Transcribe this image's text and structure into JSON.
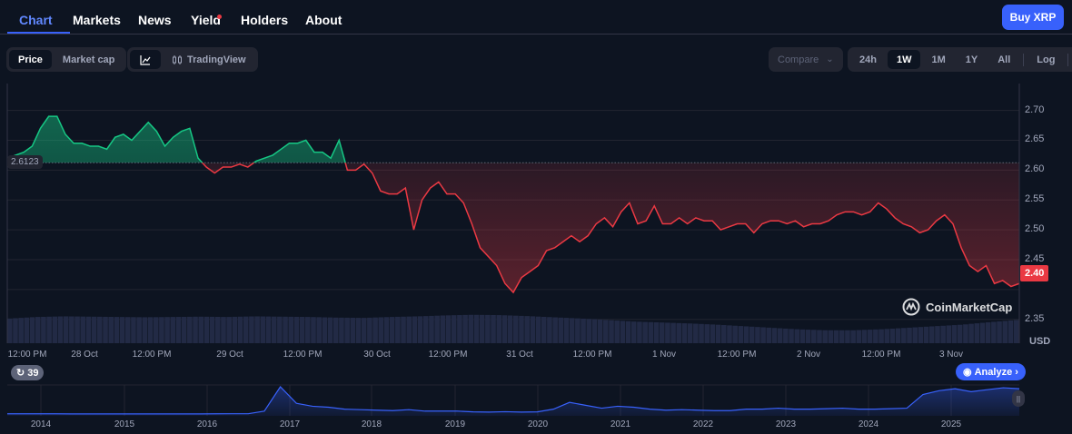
{
  "nav": {
    "tabs": [
      "Chart",
      "Markets",
      "News",
      "Yield",
      "Holders",
      "About"
    ],
    "active": "Chart",
    "buy_label": "Buy XRP"
  },
  "toolbar": {
    "price": "Price",
    "market_cap": "Market cap",
    "tradingview": "TradingView",
    "compare": "Compare",
    "ranges": [
      "24h",
      "1W",
      "1M",
      "1Y",
      "All"
    ],
    "active_range": "1W",
    "log": "Log"
  },
  "chart": {
    "baseline_label": "2.6123",
    "current_label": "2.40",
    "currency": "USD",
    "watermark": "CoinMarketCap",
    "y_ticks": [
      "2.70",
      "2.65",
      "2.60",
      "2.55",
      "2.50",
      "2.45",
      "2.35"
    ],
    "x_ticks": [
      "12:00 PM",
      "28 Oct",
      "12:00 PM",
      "29 Oct",
      "12:00 PM",
      "30 Oct",
      "12:00 PM",
      "31 Oct",
      "12:00 PM",
      "1 Nov",
      "12:00 PM",
      "2 Nov",
      "12:00 PM",
      "3 Nov"
    ],
    "colors": {
      "up": "#16c784",
      "down": "#ea3943",
      "accent": "#3861fb"
    },
    "baseline": 2.6123,
    "ylim": [
      2.31,
      2.745
    ],
    "prices": [
      2.62,
      2.625,
      2.63,
      2.64,
      2.67,
      2.69,
      2.69,
      2.66,
      2.645,
      2.645,
      2.64,
      2.64,
      2.635,
      2.655,
      2.66,
      2.65,
      2.665,
      2.68,
      2.665,
      2.64,
      2.655,
      2.665,
      2.67,
      2.62,
      2.605,
      2.595,
      2.605,
      2.605,
      2.61,
      2.605,
      2.615,
      2.62,
      2.625,
      2.635,
      2.645,
      2.645,
      2.65,
      2.63,
      2.63,
      2.62,
      2.65,
      2.6,
      2.6,
      2.61,
      2.595,
      2.565,
      2.56,
      2.56,
      2.57,
      2.5,
      2.55,
      2.57,
      2.58,
      2.56,
      2.56,
      2.545,
      2.51,
      2.47,
      2.455,
      2.44,
      2.41,
      2.395,
      2.42,
      2.43,
      2.44,
      2.465,
      2.47,
      2.48,
      2.49,
      2.48,
      2.49,
      2.51,
      2.52,
      2.505,
      2.53,
      2.545,
      2.51,
      2.515,
      2.54,
      2.51,
      2.51,
      2.52,
      2.51,
      2.52,
      2.515,
      2.515,
      2.5,
      2.505,
      2.51,
      2.51,
      2.495,
      2.51,
      2.515,
      2.515,
      2.51,
      2.515,
      2.505,
      2.51,
      2.51,
      2.515,
      2.525,
      2.53,
      2.53,
      2.525,
      2.53,
      2.545,
      2.535,
      2.52,
      2.51,
      2.505,
      2.495,
      2.5,
      2.515,
      2.525,
      2.51,
      2.47,
      2.44,
      2.43,
      2.44,
      2.41,
      2.415,
      2.405,
      2.41
    ],
    "volume": [
      0.8,
      0.85,
      0.87,
      0.86,
      0.85,
      0.84,
      0.85,
      0.86,
      0.85,
      0.87,
      0.86,
      0.85,
      0.83,
      0.82,
      0.85,
      0.87,
      0.9,
      0.92,
      0.91,
      0.88,
      0.84,
      0.8,
      0.75,
      0.7,
      0.67,
      0.64,
      0.6,
      0.55,
      0.5,
      0.45,
      0.42,
      0.42,
      0.45,
      0.5,
      0.55,
      0.6,
      0.68,
      0.75
    ]
  },
  "history": {
    "badge": "39",
    "analyze": "Analyze",
    "years": [
      "2014",
      "2015",
      "2016",
      "2017",
      "2018",
      "2019",
      "2020",
      "2021",
      "2022",
      "2023",
      "2024",
      "2025"
    ],
    "values": [
      0.02,
      0.02,
      0.02,
      0.02,
      0.01,
      0.01,
      0.01,
      0.01,
      0.01,
      0.01,
      0.01,
      0.01,
      0.01,
      0.02,
      0.03,
      0.03,
      0.3,
      2.8,
      1.1,
      0.8,
      0.7,
      0.5,
      0.45,
      0.4,
      0.35,
      0.45,
      0.3,
      0.3,
      0.3,
      0.22,
      0.2,
      0.24,
      0.2,
      0.22,
      0.5,
      1.2,
      0.9,
      0.6,
      0.8,
      0.7,
      0.5,
      0.4,
      0.45,
      0.4,
      0.35,
      0.35,
      0.5,
      0.5,
      0.6,
      0.5,
      0.5,
      0.55,
      0.6,
      0.5,
      0.5,
      0.55,
      0.6,
      2.0,
      2.4,
      2.6,
      2.3,
      2.5,
      2.7,
      2.6
    ]
  }
}
